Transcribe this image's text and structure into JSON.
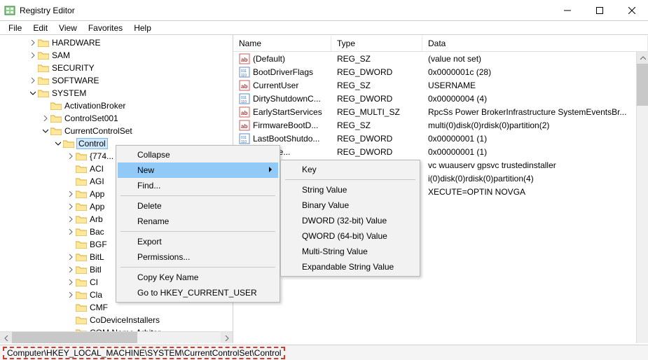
{
  "window": {
    "title": "Registry Editor"
  },
  "menu": {
    "file": "File",
    "edit": "Edit",
    "view": "View",
    "favorites": "Favorites",
    "help": "Help"
  },
  "tree": {
    "HARDWARE": "HARDWARE",
    "SAM": "SAM",
    "SECURITY": "SECURITY",
    "SOFTWARE": "SOFTWARE",
    "SYSTEM": "SYSTEM",
    "ActivationBroker": "ActivationBroker",
    "ControlSet001": "ControlSet001",
    "CurrentControlSet": "CurrentControlSet",
    "Control": "Control",
    "i0": "{774...",
    "i1": "ACI",
    "i2": "AGI",
    "i3": "App",
    "i4": "App",
    "i5": "Arb",
    "i6": "Bac",
    "i7": "BGF",
    "i8": "BitL",
    "i9": "Bitl",
    "i10": "CI",
    "i11": "Cla",
    "i12": "CMF",
    "i13": "CoDeviceInstallers",
    "i14": "COM Name Arbiter"
  },
  "columns": {
    "name": "Name",
    "type": "Type",
    "data": "Data"
  },
  "rows": [
    {
      "icon": "str",
      "name": "(Default)",
      "type": "REG_SZ",
      "data": "(value not set)"
    },
    {
      "icon": "bin",
      "name": "BootDriverFlags",
      "type": "REG_DWORD",
      "data": "0x0000001c (28)"
    },
    {
      "icon": "str",
      "name": "CurrentUser",
      "type": "REG_SZ",
      "data": "USERNAME"
    },
    {
      "icon": "bin",
      "name": "DirtyShutdownC...",
      "type": "REG_DWORD",
      "data": "0x00000004 (4)"
    },
    {
      "icon": "str",
      "name": "EarlyStartServices",
      "type": "REG_MULTI_SZ",
      "data": "RpcSs Power BrokerInfrastructure SystemEventsBr..."
    },
    {
      "icon": "str",
      "name": "FirmwareBootD...",
      "type": "REG_SZ",
      "data": "multi(0)disk(0)rdisk(0)partition(2)"
    },
    {
      "icon": "bin",
      "name": "LastBootShutdo...",
      "type": "REG_DWORD",
      "data": "0x00000001 (1)"
    },
    {
      "icon": "bin",
      "name": "tSuccee...",
      "type": "REG_DWORD",
      "data": "0x00000001 (1)"
    },
    {
      "icon": "str",
      "name": "",
      "type": "",
      "data": "vc wuauserv gpsvc trustedinstaller"
    },
    {
      "icon": "str",
      "name": "",
      "type": "",
      "data": "i(0)disk(0)rdisk(0)partition(4)"
    },
    {
      "icon": "str",
      "name": "",
      "type": "",
      "data": "XECUTE=OPTIN  NOVGA"
    }
  ],
  "ctx1": {
    "collapse": "Collapse",
    "new": "New",
    "find": "Find...",
    "delete": "Delete",
    "rename": "Rename",
    "export": "Export",
    "permissions": "Permissions...",
    "copykey": "Copy Key Name",
    "goto": "Go to HKEY_CURRENT_USER"
  },
  "ctx2": {
    "key": "Key",
    "string": "String Value",
    "binary": "Binary Value",
    "dword": "DWORD (32-bit) Value",
    "qword": "QWORD (64-bit) Value",
    "multi": "Multi-String Value",
    "expand": "Expandable String Value"
  },
  "status": {
    "path": "Computer\\HKEY_LOCAL_MACHINE\\SYSTEM\\CurrentControlSet\\Control"
  }
}
